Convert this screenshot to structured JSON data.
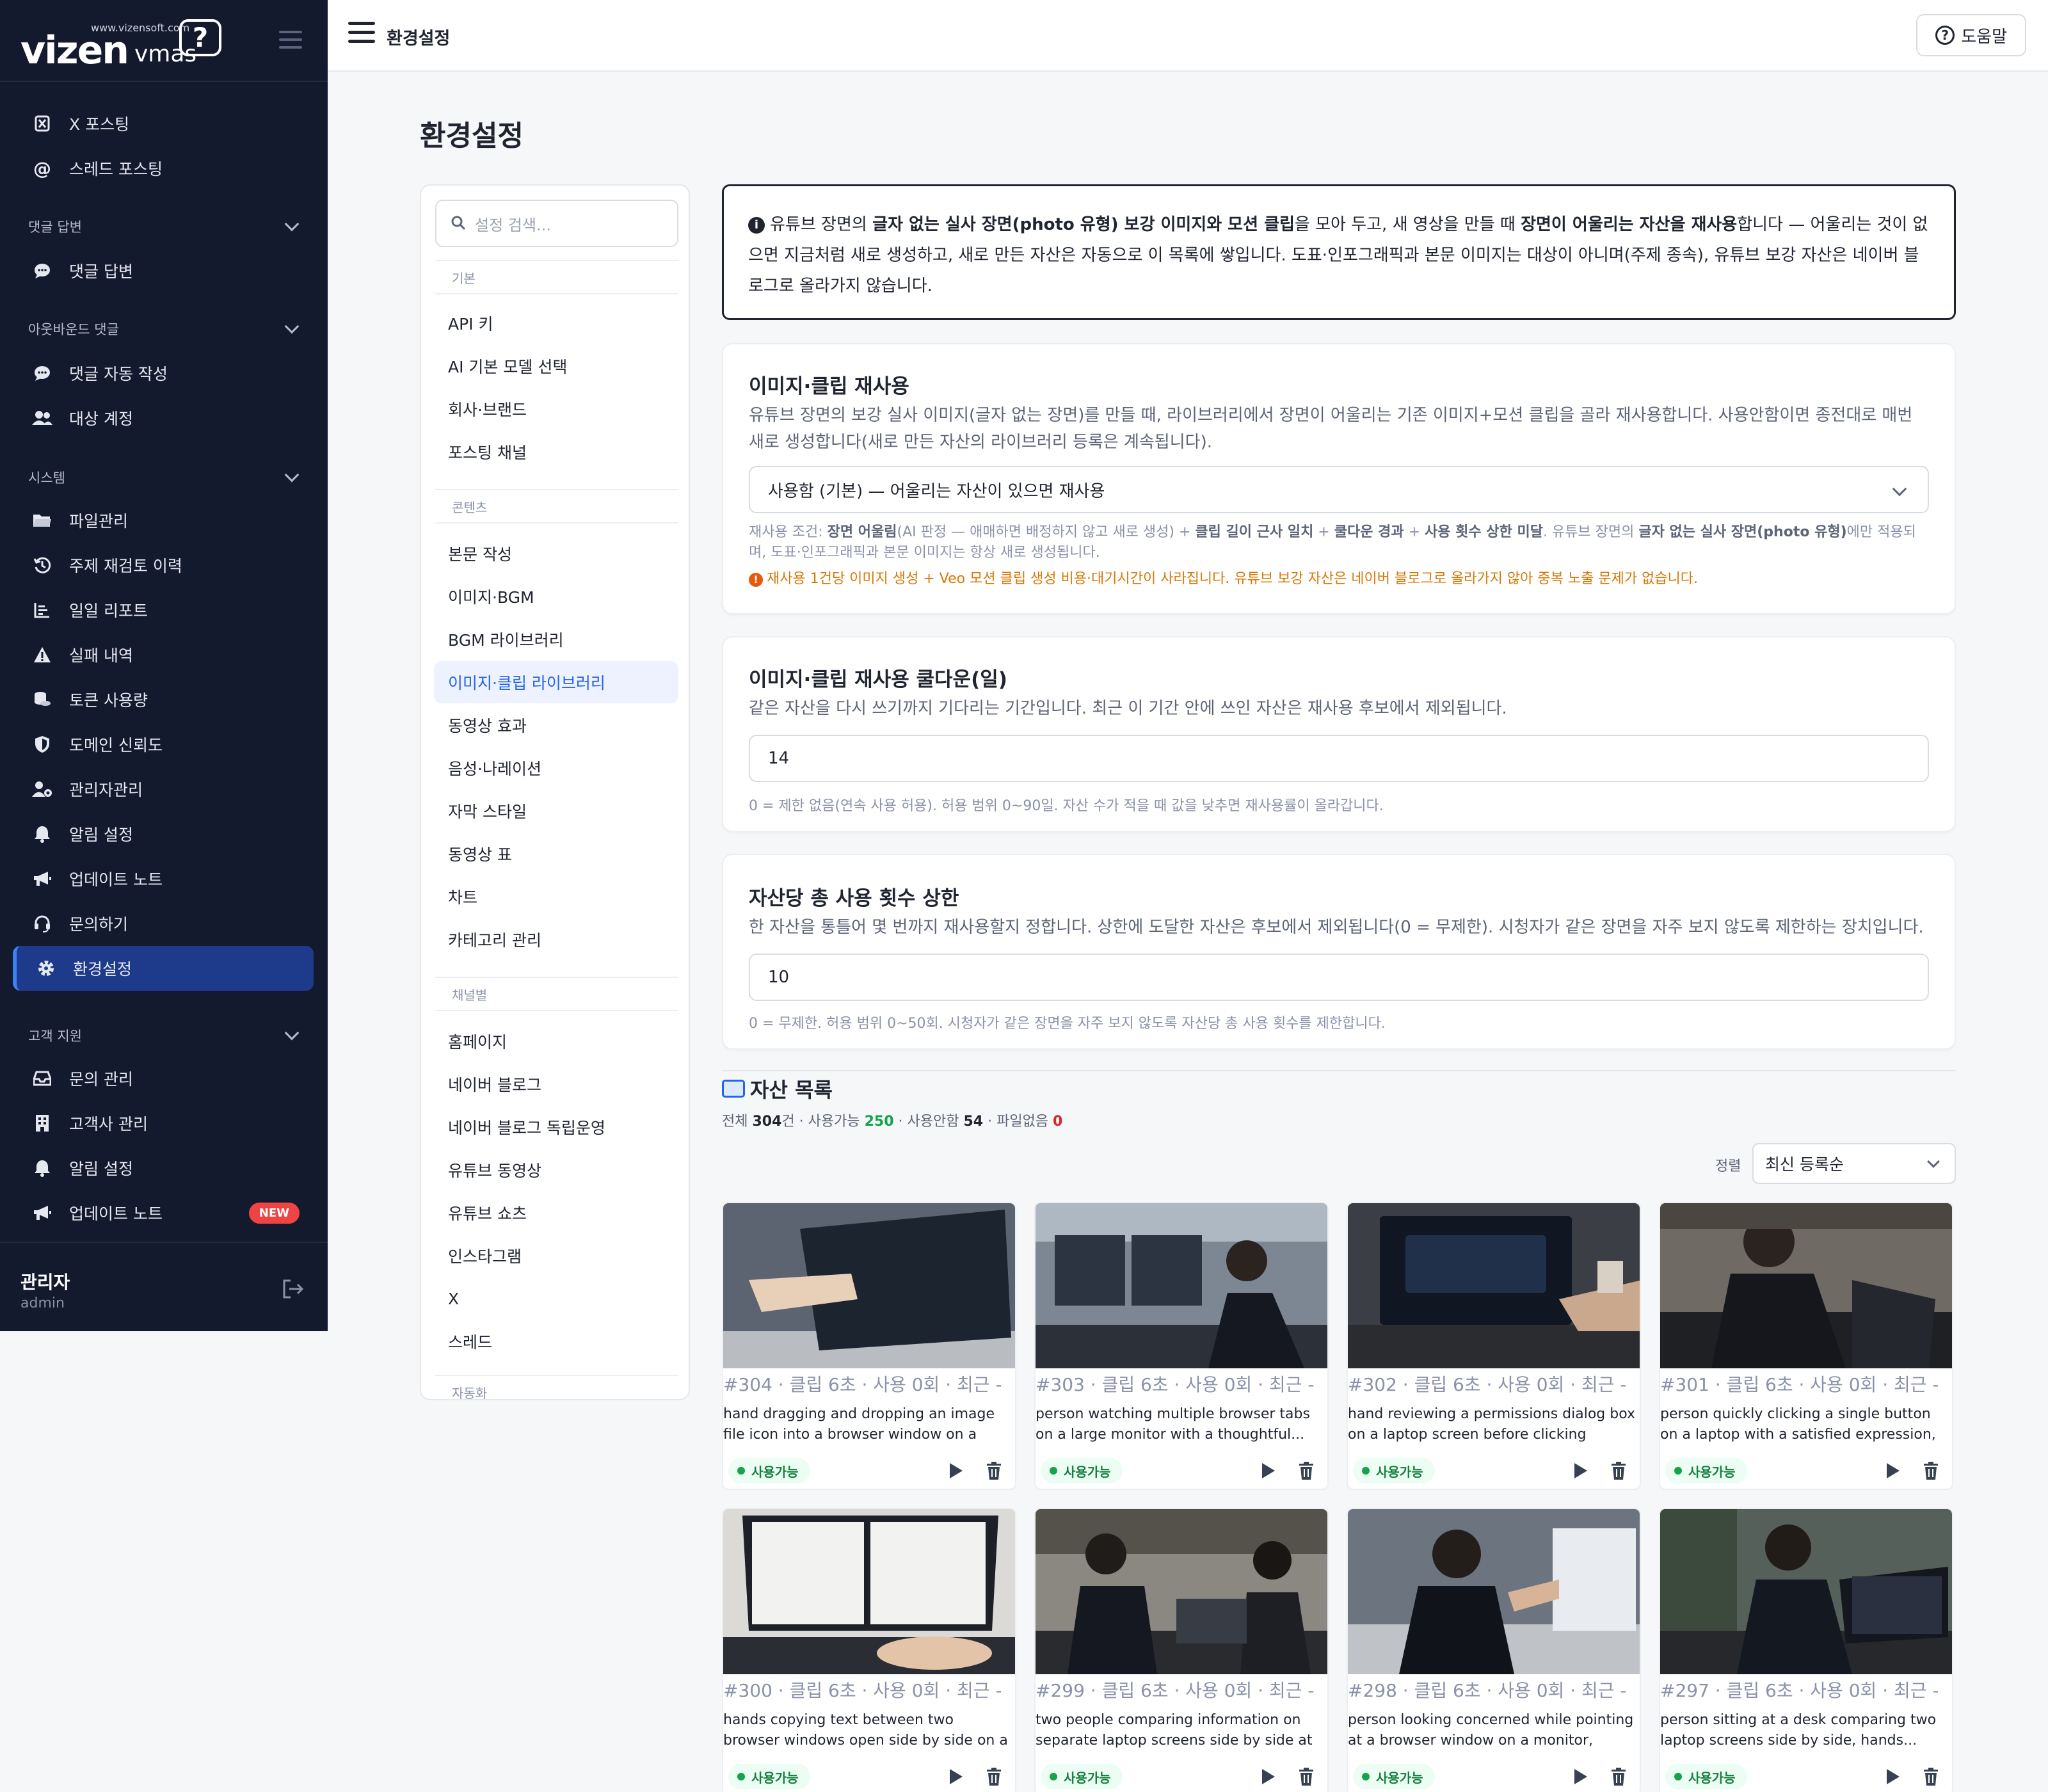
{
  "app": {
    "logo_url": "www.vizensoft.com",
    "logo_main": "vizen",
    "logo_sub": "vmas",
    "logo_bubble": "?"
  },
  "sidebar": {
    "items_top": [
      {
        "label": "X 포스팅",
        "icon": "x-logo-icon"
      },
      {
        "label": "스레드 포스팅",
        "icon": "at-sign-icon"
      }
    ],
    "sections": [
      {
        "label": "댓글 답변",
        "items": [
          {
            "label": "댓글 답변",
            "icon": "chat-bubble-icon"
          }
        ]
      },
      {
        "label": "아웃바운드 댓글",
        "items": [
          {
            "label": "댓글 자동 작성",
            "icon": "chat-bubble-icon"
          },
          {
            "label": "대상 계정",
            "icon": "users-icon"
          }
        ]
      },
      {
        "label": "시스템",
        "items": [
          {
            "label": "파일관리",
            "icon": "folder-icon"
          },
          {
            "label": "주제 재검토 이력",
            "icon": "history-icon"
          },
          {
            "label": "일일 리포트",
            "icon": "chart-bar-icon"
          },
          {
            "label": "실패 내역",
            "icon": "warning-icon"
          },
          {
            "label": "토큰 사용량",
            "icon": "coins-icon"
          },
          {
            "label": "도메인 신뢰도",
            "icon": "shield-icon"
          },
          {
            "label": "관리자관리",
            "icon": "user-gear-icon"
          },
          {
            "label": "알림 설정",
            "icon": "bell-icon"
          },
          {
            "label": "업데이트 노트",
            "icon": "megaphone-icon"
          },
          {
            "label": "문의하기",
            "icon": "headset-icon"
          },
          {
            "label": "환경설정",
            "icon": "gear-icon",
            "active": true
          }
        ]
      },
      {
        "label": "고객 지원",
        "items": [
          {
            "label": "문의 관리",
            "icon": "inbox-icon"
          },
          {
            "label": "고객사 관리",
            "icon": "building-icon"
          },
          {
            "label": "알림 설정",
            "icon": "bell-icon"
          },
          {
            "label": "업데이트 노트",
            "icon": "megaphone-icon",
            "badge": "NEW"
          }
        ]
      }
    ],
    "user_name": "관리자",
    "user_id": "admin"
  },
  "topbar": {
    "title": "환경설정",
    "help_label": "도움말"
  },
  "page": {
    "title": "환경설정"
  },
  "settings_nav": {
    "search_placeholder": "설정 검색...",
    "groups": [
      {
        "label": "기본",
        "items": [
          "API 키",
          "AI 기본 모델 선택",
          "회사·브랜드",
          "포스팅 채널"
        ]
      },
      {
        "label": "콘텐츠",
        "items": [
          "본문 작성",
          "이미지·BGM",
          "BGM 라이브러리",
          "이미지·클립 라이브러리",
          "동영상 효과",
          "음성·나레이션",
          "자막 스타일",
          "동영상 표",
          "차트",
          "카테고리 관리"
        ]
      },
      {
        "label": "채널별",
        "items": [
          "홈페이지",
          "네이버 블로그",
          "네이버 블로그 독립운영",
          "유튜브 동영상",
          "유튜브 쇼츠",
          "인스타그램",
          "X",
          "스레드"
        ]
      },
      {
        "label": "자동화",
        "items": []
      }
    ],
    "active_item": "이미지·클립 라이브러리"
  },
  "info": {
    "p1": "유튜브 장면의 ",
    "b1": "글자 없는 실사 장면(photo 유형) 보강 이미지와 모션 클립",
    "p2": "을 모아 두고, 새 영상을 만들 때 ",
    "b2": "장면이 어울리는 자산을 재사용",
    "p3": "합니다 — 어울리는 것이 없으면 지금처럼 새로 생성하고, 새로 만든 자산은 자동으로 이 목록에 쌓입니다. 도표·인포그래픽과 본문 이미지는 대상이 아니며(주제 종속), 유튜브 보강 자산은 네이버 블로그로 올라가지 않습니다."
  },
  "reuse_card": {
    "title": "이미지·클립 재사용",
    "desc": "유튜브 장면의 보강 실사 이미지(글자 없는 장면)를 만들 때, 라이브러리에서 장면이 어울리는 기존 이미지+모션 클립을 골라 재사용합니다. 사용안함이면 종전대로 매번 새로 생성합니다(새로 만든 자산의 라이브러리 등록은 계속됩니다).",
    "select_value": "사용함 (기본) — 어울리는 자산이 있으면 재사용",
    "hint_prefix": "재사용 조건: ",
    "hint_b1": "장면 어울림",
    "hint_t1": "(AI 판정 — 애매하면 배정하지 않고 새로 생성) + ",
    "hint_b2": "클립 길이 근사 일치",
    "hint_t2": " + ",
    "hint_b3": "쿨다운 경과",
    "hint_t3": " + ",
    "hint_b4": "사용 횟수 상한 미달",
    "hint_t4": ". 유튜브 장면의 ",
    "hint_b5": "글자 없는 실사 장면(photo 유형)",
    "hint_t5": "에만 적용되며, 도표·인포그래픽과 본문 이미지는 항상 새로 생성됩니다.",
    "warn": "재사용 1건당 이미지 생성 + Veo 모션 클립 생성 비용·대기시간이 사라집니다. 유튜브 보강 자산은 네이버 블로그로 올라가지 않아 중복 노출 문제가 없습니다."
  },
  "cooldown_card": {
    "title": "이미지·클립 재사용 쿨다운(일)",
    "desc": "같은 자산을 다시 쓰기까지 기다리는 기간입니다. 최근 이 기간 안에 쓰인 자산은 재사용 후보에서 제외됩니다.",
    "value": "14",
    "hint": "0 = 제한 없음(연속 사용 허용). 허용 범위 0~90일. 자산 수가 적을 때 값을 낮추면 재사용률이 올라갑니다."
  },
  "limit_card": {
    "title": "자산당 총 사용 횟수 상한",
    "desc": "한 자산을 통틀어 몇 번까지 재사용할지 정합니다. 상한에 도달한 자산은 후보에서 제외됩니다(0 = 무제한). 시청자가 같은 장면을 자주 보지 않도록 제한하는 장치입니다.",
    "value": "10",
    "hint": "0 = 무제한. 허용 범위 0~50회. 시청자가 같은 장면을 자주 보지 않도록 자산당 총 사용 횟수를 제한합니다."
  },
  "assets": {
    "title": "자산 목록",
    "stats_total_label": "전체 ",
    "stats_total": "304",
    "stats_total_unit": "건 · 사용가능 ",
    "stats_available": "250",
    "stats_unused_label": " · 사용안함 ",
    "stats_unused": "54",
    "stats_missing_label": " · 파일없음 ",
    "stats_missing": "0",
    "sort_label": "정렬",
    "sort_value": "최신 등록순",
    "items": [
      {
        "meta": "#304 · 클립 6초 · 사용 0회 · 최근 -",
        "desc": "hand dragging and dropping an image file icon into a browser window on a laptop...",
        "status": "사용가능"
      },
      {
        "meta": "#303 · 클립 6초 · 사용 0회 · 최근 -",
        "desc": "person watching multiple browser tabs on a large monitor with a thoughtful...",
        "status": "사용가능"
      },
      {
        "meta": "#302 · 클립 6초 · 사용 0회 · 최근 -",
        "desc": "hand reviewing a permissions dialog box on a laptop screen before clicking install,...",
        "status": "사용가능"
      },
      {
        "meta": "#301 · 클립 6초 · 사용 0회 · 최근 -",
        "desc": "person quickly clicking a single button on a laptop with a satisfied expression, fast...",
        "status": "사용가능"
      },
      {
        "meta": "#300 · 클립 6초 · 사용 0회 · 최근 -",
        "desc": "hands copying text between two browser windows open side by side on a laptop...",
        "status": "사용가능"
      },
      {
        "meta": "#299 · 클립 6초 · 사용 0회 · 최근 -",
        "desc": "two people comparing information on separate laptop screens side by side at a...",
        "status": "사용가능"
      },
      {
        "meta": "#298 · 클립 6초 · 사용 0회 · 최근 -",
        "desc": "person looking concerned while pointing at a browser window on a monitor, anoth...",
        "status": "사용가능"
      },
      {
        "meta": "#297 · 클립 6초 · 사용 0회 · 최근 -",
        "desc": "person sitting at a desk comparing two laptop screens side by side, hands...",
        "status": "사용가능"
      }
    ]
  },
  "colors": {
    "sidebar_bg": "#141a2e",
    "accent": "#2563eb",
    "active_item_bg": "#1e3a8a",
    "badge_new": "#ef4444",
    "status_green": "#16a34a",
    "warning": "#d97706"
  }
}
